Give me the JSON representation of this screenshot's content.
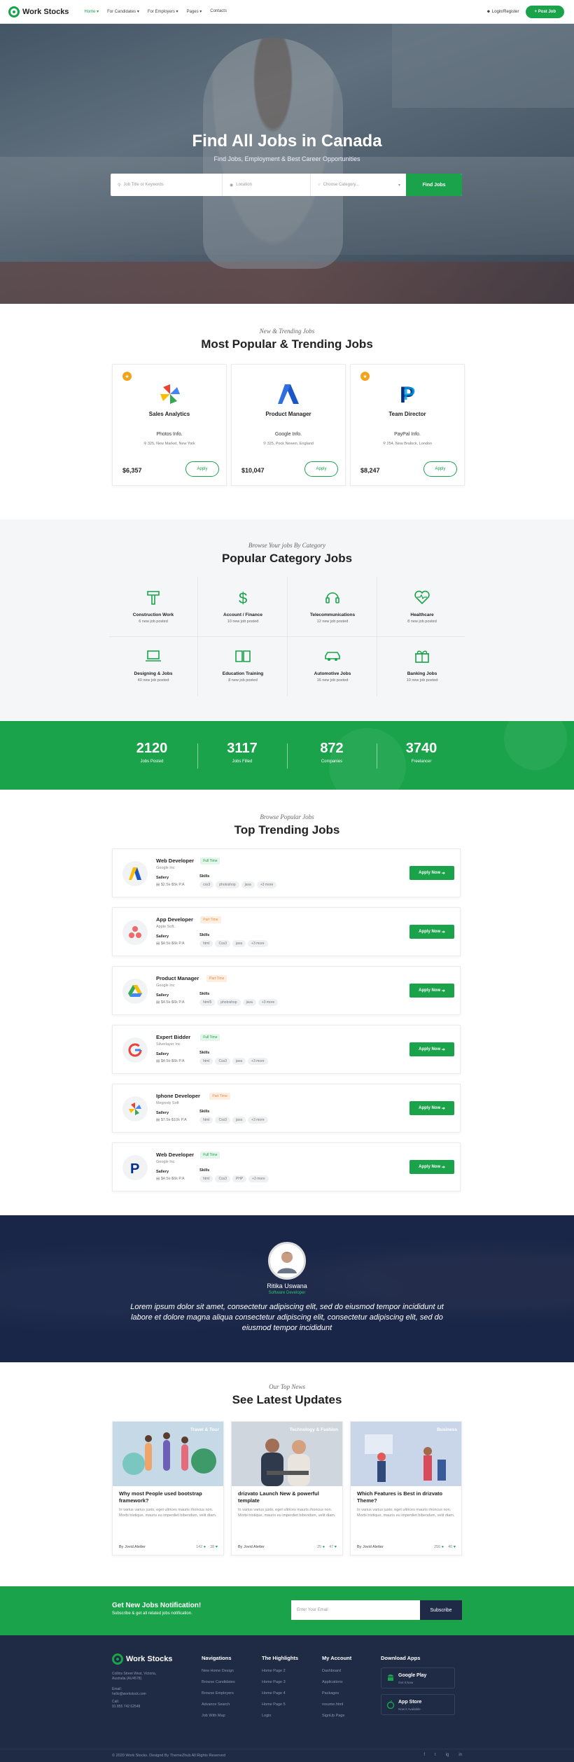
{
  "header": {
    "logo": "Work Stocks",
    "nav": [
      "Home",
      "For Candidates",
      "For Employers",
      "Pages",
      "Contacts"
    ],
    "login": "Login/Register",
    "post_job": "+ Post Job"
  },
  "hero": {
    "title": "Find All Jobs in Canada",
    "subtitle": "Find Jobs, Employment & Best Career Opportunities",
    "keyword_placeholder": "Job Title or Keywords",
    "location_placeholder": "Location",
    "category_placeholder": "Choose Category...",
    "button": "Find Jobs"
  },
  "popular": {
    "eyebrow": "New & Trending Jobs",
    "title": "Most Popular & Trending Jobs",
    "cards": [
      {
        "title": "Sales Analytics",
        "company": "Photos Info.",
        "location": "325, New Market, New York",
        "salary": "$6,357",
        "apply": "Apply",
        "featured": true
      },
      {
        "title": "Product Manager",
        "company": "Google Info.",
        "location": "325, Pock Newen, England",
        "salary": "$10,047",
        "apply": "Apply",
        "featured": false
      },
      {
        "title": "Team Director",
        "company": "PayPal Info.",
        "location": "254, New Bralock, London",
        "salary": "$8,247",
        "apply": "Apply",
        "featured": true
      }
    ]
  },
  "categories": {
    "eyebrow": "Browse Your jobs By Category",
    "title": "Popular Category Jobs",
    "items": [
      {
        "name": "Construction Work",
        "count": "6 new job posted"
      },
      {
        "name": "Account / Finance",
        "count": "10 new job posted"
      },
      {
        "name": "Telecommunications",
        "count": "12 new job posted"
      },
      {
        "name": "Healthcare",
        "count": "8 new job posted"
      },
      {
        "name": "Designing & Jobs",
        "count": "40 new job posted"
      },
      {
        "name": "Education Training",
        "count": "8 new job posted"
      },
      {
        "name": "Automotive Jobs",
        "count": "16 new job posted"
      },
      {
        "name": "Banking Jobs",
        "count": "10 new job posted"
      }
    ]
  },
  "counters": [
    {
      "value": "2120",
      "label": "Jobs Posted"
    },
    {
      "value": "3117",
      "label": "Jobs Filled"
    },
    {
      "value": "872",
      "label": "Companies"
    },
    {
      "value": "3740",
      "label": "Freelancer"
    }
  ],
  "trending": {
    "eyebrow": "Browse Popular Jobs",
    "title": "Top Trending Jobs",
    "salary_label": "Sallery",
    "skills_label": "Skills",
    "apply": "Apply Now",
    "jobs": [
      {
        "title": "Web Developer",
        "type": "Full Time",
        "company": "Google Inc",
        "salary": "$2.5k-$5k P.A",
        "skills": [
          "css3",
          "photoshop",
          "java",
          "+3 more"
        ]
      },
      {
        "title": "App Developer",
        "type": "Part Time",
        "company": "Apple Soft.",
        "salary": "$4.5k-$6k P.A",
        "skills": [
          "html",
          "Css3",
          "java",
          "+3 more"
        ]
      },
      {
        "title": "Product Manager",
        "type": "Part Time",
        "company": "Google Inc",
        "salary": "$4.5k-$6k P.A",
        "skills": [
          "html5",
          "photoshop",
          "java",
          "+3 more"
        ]
      },
      {
        "title": "Expert Bidder",
        "type": "Full Time",
        "company": "Silverlayer Inc",
        "salary": "$4.5k-$6k P.A",
        "skills": [
          "html",
          "Css3",
          "java",
          "+3 more"
        ]
      },
      {
        "title": "Iphone Developer",
        "type": "Part Time",
        "company": "Megrody Soft",
        "salary": "$7.5k-$10k P.A",
        "skills": [
          "html",
          "Css3",
          "java",
          "+3 more"
        ]
      },
      {
        "title": "Web Developer",
        "type": "Full Time",
        "company": "Google Inc",
        "salary": "$4.5k-$6k P.A",
        "skills": [
          "html",
          "Css3",
          "PHP",
          "+3 more"
        ]
      }
    ]
  },
  "testimonial": {
    "name": "Ritika Uswana",
    "role": "Software Developer",
    "quote": "Lorem ipsum dolor sit amet, consectetur adipiscing elit, sed do eiusmod tempor incididunt ut labore et dolore magna aliqua consectetur adipiscing elit, consectetur adipiscing elit, sed do eiusmod tempor incididunt"
  },
  "news": {
    "eyebrow": "Our Top News",
    "title": "See Latest Updates",
    "by_label": "By",
    "posts": [
      {
        "tag": "Travel & Tour",
        "title": "Why most People used bootstrap framework?",
        "text": "In varius varius justo, eget ultrices mauris rhoncus non. Morbi tristique, mauris eu imperdiet bibendum, velit diam.",
        "author": "Jovid Aletter",
        "comments": "142",
        "likes": "38"
      },
      {
        "tag": "Technology & Fashion",
        "title": "drizvato Launch New & powerful template",
        "text": "In varius varius justo, eget ultrices mauris rhoncus non. Morbi tristique, mauris eu imperdiet bibendum, velit diam.",
        "author": "Jovid Aletter",
        "comments": "25",
        "likes": "47"
      },
      {
        "tag": "Business",
        "title": "Which Features is Best in drizvato Theme?",
        "text": "In varius varius justo, eget ultrices mauris rhoncus non. Morbi tristique, mauris eu imperdiet bibendum, velit diam.",
        "author": "Jovid Aletter",
        "comments": "256",
        "likes": "40"
      }
    ]
  },
  "newsletter": {
    "title": "Get New Jobs Notification!",
    "subtitle": "Subscribe & get all related jobs notification.",
    "placeholder": "Enter Your Email",
    "button": "Subscribe"
  },
  "footer": {
    "logo": "Work Stocks",
    "address": "Collins Street West, Victoria, Australia (AU4578)",
    "email_label": "Email:",
    "email": "hello@workstock.com",
    "call_label": "Call:",
    "phone": "91 855 742 62548",
    "columns": [
      {
        "title": "Navigations",
        "links": [
          "New Home Design",
          "Browse Candidates",
          "Browse Employers",
          "Advance Search",
          "Job With Map"
        ]
      },
      {
        "title": "The Highlights",
        "links": [
          "Home Page 2",
          "Home Page 3",
          "Home Page 4",
          "Home Page 5",
          "Login"
        ]
      },
      {
        "title": "My Account",
        "links": [
          "Dashboard",
          "Applications",
          "Packages",
          "resume.html",
          "SignUp Page"
        ]
      }
    ],
    "download_title": "Download Apps",
    "stores": [
      {
        "name": "Google Play",
        "sub": "Get It Now"
      },
      {
        "name": "App Store",
        "sub": "Now it Available"
      }
    ],
    "copyright": "© 2020 Work Stocks. Designd By ThemeZhub All Rights Reserved",
    "social": [
      "f",
      "t",
      "ig",
      "in"
    ]
  },
  "colors": {
    "brand": "#1aa34a",
    "dark": "#1f2a44",
    "featured": "#f2a31b"
  }
}
